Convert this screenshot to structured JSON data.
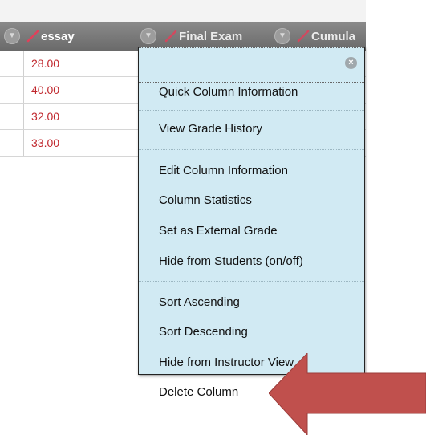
{
  "header": {
    "columns": [
      {
        "label": "essay"
      },
      {
        "label": "Final Exam"
      },
      {
        "label": "Cumula"
      }
    ]
  },
  "rows": [
    {
      "value": "28.00"
    },
    {
      "value": "40.00"
    },
    {
      "value": "32.00"
    },
    {
      "value": "33.00"
    }
  ],
  "menu": {
    "items": [
      "Quick Column Information",
      "View Grade History",
      "Edit Column Information",
      "Column Statistics",
      "Set as External Grade",
      "Hide from Students (on/off)",
      "Sort Ascending",
      "Sort Descending",
      "Hide from Instructor View",
      "Delete Column"
    ]
  },
  "colors": {
    "menu_background": "#d1eaf3",
    "value_text": "#c0272d",
    "annotation_arrow": "#c0504d",
    "header_background": "#7a7a7a"
  },
  "icons": [
    "chevron-down-icon",
    "pencil-icon",
    "close-icon",
    "arrow-annotation"
  ]
}
